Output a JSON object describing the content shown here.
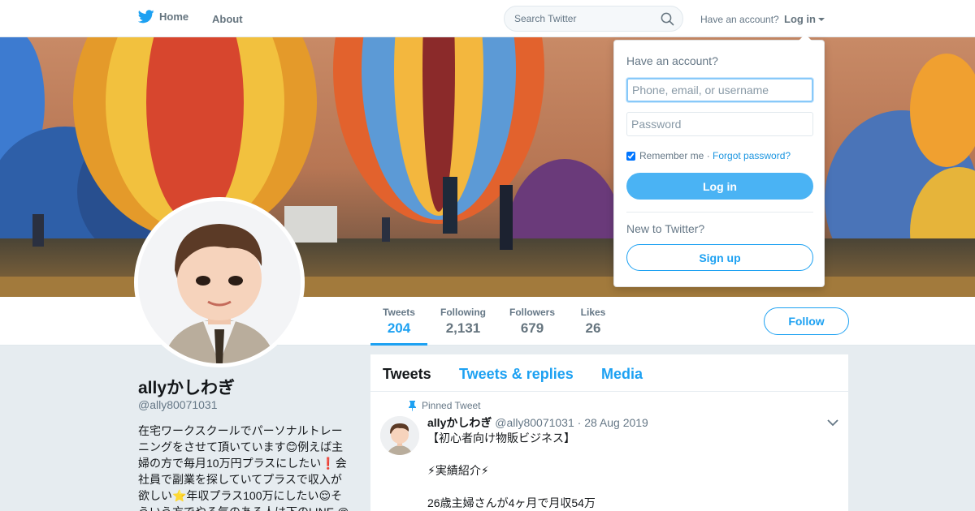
{
  "nav": {
    "home_label": "Home",
    "about_label": "About",
    "search_placeholder": "Search Twitter",
    "have_account": "Have an account?",
    "login_label": "Log in"
  },
  "profile": {
    "name": "allyかしわぎ",
    "handle": "@ally80071031",
    "bio": "在宅ワークスクールでパーソナルトレーニングをさせて頂いています😊例えば主婦の方で毎月10万円プラスにしたい❗会社員で副業を探していてプラスで収入が欲しい⭐年収プラス100万にしたい😌そういう方でやる気のある人は下のLINE @"
  },
  "stats": [
    {
      "label": "Tweets",
      "value": "204"
    },
    {
      "label": "Following",
      "value": "2,131"
    },
    {
      "label": "Followers",
      "value": "679"
    },
    {
      "label": "Likes",
      "value": "26"
    }
  ],
  "follow_label": "Follow",
  "timeline": {
    "tabs": [
      "Tweets",
      "Tweets & replies",
      "Media"
    ],
    "pinned_label": "Pinned Tweet",
    "tweet": {
      "name": "allyかしわぎ",
      "meta": "@ally80071031 · 28 Aug 2019",
      "text": "【初心者向け物販ビジネス】\n\n⚡実績紹介⚡\n\n26歳主婦さんが4ヶ月で月収54万"
    }
  },
  "login_dropdown": {
    "title": "Have an account?",
    "username_placeholder": "Phone, email, or username",
    "password_placeholder": "Password",
    "remember_label": "Remember me",
    "separator": " · ",
    "forgot_label": "Forgot password?",
    "login_button": "Log in",
    "new_label": "New to Twitter?",
    "signup_button": "Sign up"
  },
  "colors": {
    "accent": "#1da1f2",
    "login_button_bg": "#4ab3f4",
    "page_bg": "#e6ecf0"
  }
}
